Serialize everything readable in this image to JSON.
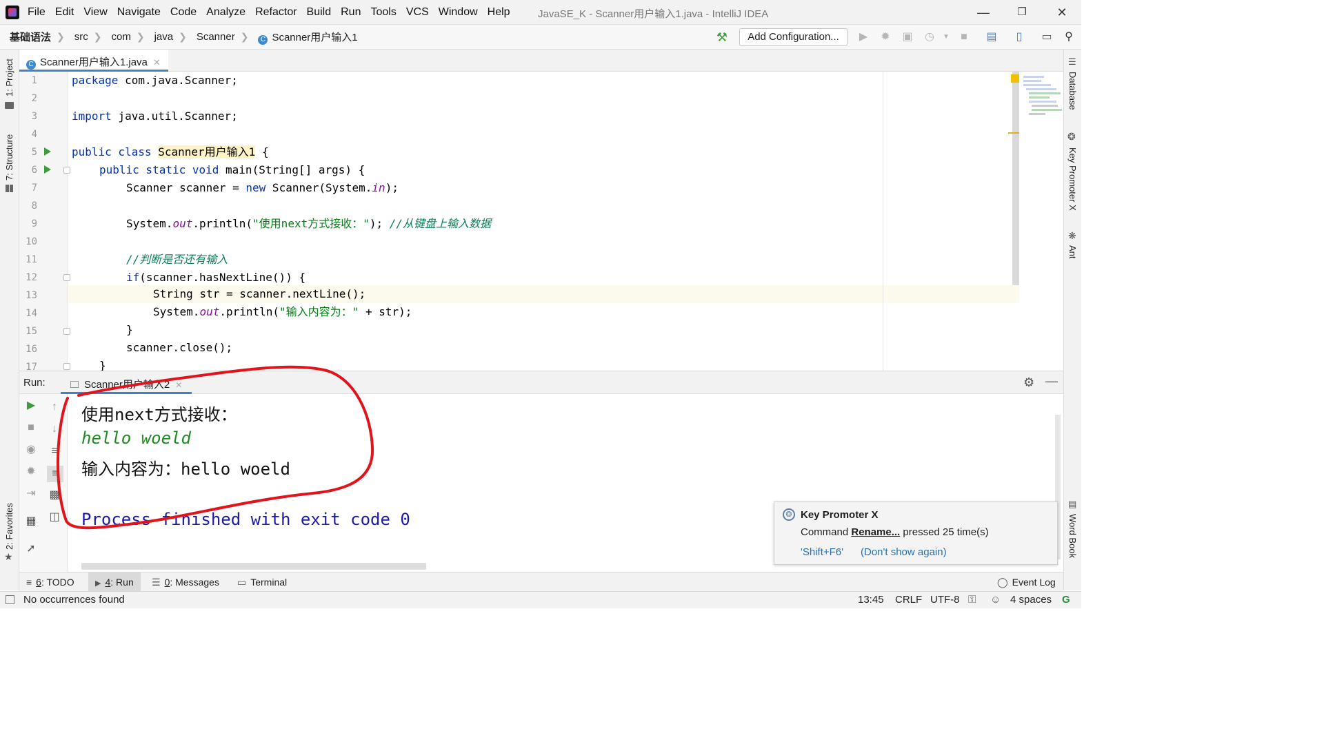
{
  "window": {
    "title": "JavaSE_K - Scanner用户输入1.java - IntelliJ IDEA"
  },
  "menu": [
    "File",
    "Edit",
    "View",
    "Navigate",
    "Code",
    "Analyze",
    "Refactor",
    "Build",
    "Run",
    "Tools",
    "VCS",
    "Window",
    "Help"
  ],
  "breadcrumb": [
    "基础语法",
    "src",
    "com",
    "java",
    "Scanner",
    "Scanner用户输入1"
  ],
  "toolbar": {
    "add_configuration": "Add Configuration..."
  },
  "left_tools": {
    "project": "1: Project",
    "structure": "7: Structure",
    "favorites": "2: Favorites"
  },
  "right_tools": {
    "database": "Database",
    "key_promoter": "Key Promoter X",
    "ant": "Ant",
    "word_book": "Word Book"
  },
  "editor_tab": {
    "label": "Scanner用户输入1.java"
  },
  "code": {
    "line_numbers": [
      "1",
      "2",
      "3",
      "4",
      "5",
      "6",
      "7",
      "8",
      "9",
      "10",
      "11",
      "12",
      "13",
      "14",
      "15",
      "16",
      "17"
    ],
    "l1_kw": "package",
    "l1_rest": " com.java.Scanner;",
    "l3_kw": "import",
    "l3_rest": " java.util.Scanner;",
    "l5_kw": "public class ",
    "l5_cls": "Scanner用户输入1",
    "l5_rest": " {",
    "l6_kw": "public static void ",
    "l6_rest": "main(String[] args) {",
    "l7_a": "Scanner scanner = ",
    "l7_kw": "new",
    "l7_b": " Scanner(System.",
    "l7_it": "in",
    "l7_c": ");",
    "l9_a": "System.",
    "l9_it": "out",
    "l9_b": ".println(",
    "l9_str": "\"使用next方式接收：\"",
    "l9_c": "); ",
    "l9_cm": "//从键盘上输入数据",
    "l11_cm": "//判断是否还有输入",
    "l12_kw": "if",
    "l12_rest": "(scanner.hasNextLine()) {",
    "l13": "String str = scanner.nextLine();",
    "l14_a": "System.",
    "l14_it": "out",
    "l14_b": ".println(",
    "l14_str": "\"输入内容为：\"",
    "l14_c": " + str);",
    "l15": "}",
    "l16": "scanner.close();",
    "l17": "}"
  },
  "run_panel": {
    "label": "Run:",
    "tab": "Scanner用户输入2",
    "output": {
      "line1": "使用next方式接收：",
      "line2": "hello woeld",
      "line3": "输入内容为：hello woeld",
      "line4": "Process finished with exit code 0"
    }
  },
  "notification": {
    "title": "Key Promoter X",
    "msg_pre": "Command ",
    "msg_cmd": "Rename...",
    "msg_post": " pressed 25 time(s)",
    "shortcut": "'Shift+F6'",
    "dismiss": "(Don't show again)"
  },
  "tool_windows": {
    "todo_num": "6",
    "todo_label": ": TODO",
    "run_num": "4",
    "run_label": ": Run",
    "messages_num": "0",
    "messages_label": ": Messages",
    "terminal": "Terminal",
    "event_log": "Event Log"
  },
  "status": {
    "message": "No occurrences found",
    "position": "13:45",
    "line_sep": "CRLF",
    "encoding": "UTF-8",
    "indent": "4 spaces"
  },
  "colors": {
    "accent": "#4083c9",
    "annotation_red": "#e0141c",
    "keyword": "#0033b3",
    "string": "#067d17",
    "comment": "#0b7d5b"
  }
}
